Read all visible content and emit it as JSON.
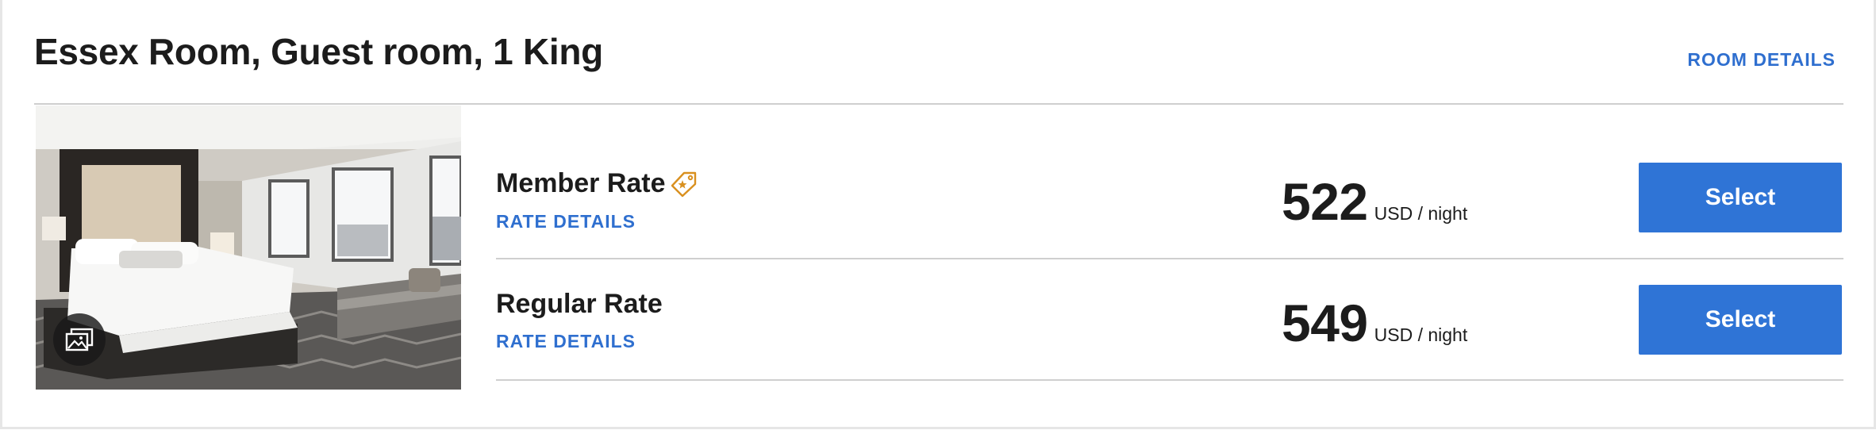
{
  "room": {
    "title": "Essex Room, Guest room, 1 King",
    "details_link": "ROOM DETAILS",
    "photo_icon": "gallery-icon"
  },
  "rates": [
    {
      "name": "Member Rate",
      "badge_icon": "member-tag-icon",
      "details_link": "RATE DETAILS",
      "price": "522",
      "unit": "USD / night",
      "button": "Select"
    },
    {
      "name": "Regular Rate",
      "details_link": "RATE DETAILS",
      "price": "549",
      "unit": "USD / night",
      "button": "Select"
    }
  ],
  "colors": {
    "accent": "#2f74d6",
    "link": "#2f6fcf",
    "member_tag": "#d9901f",
    "divider": "#cfcfcf"
  }
}
